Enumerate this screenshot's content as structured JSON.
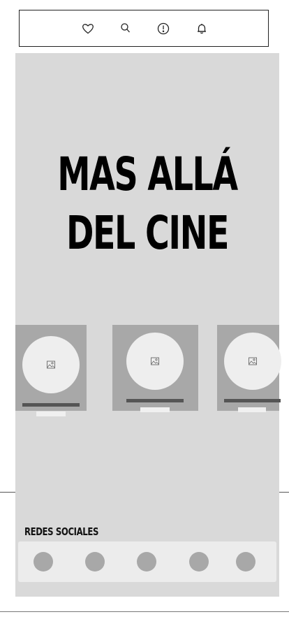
{
  "topbar": {
    "icons": [
      "heart-icon",
      "search-icon",
      "alert-icon",
      "bell-icon"
    ]
  },
  "hero": {
    "line1": "MAS ALLÁ",
    "line2": "DEL CINE"
  },
  "carousel": {
    "cards": [
      {
        "image": "image-placeholder-icon"
      },
      {
        "image": "image-placeholder-icon"
      },
      {
        "image": "image-placeholder-icon"
      }
    ]
  },
  "social": {
    "title": "REDES SOCIALES",
    "links": [
      "social-link",
      "social-link",
      "social-link",
      "social-link",
      "social-link"
    ]
  },
  "colors": {
    "panel": "#d9d9d9",
    "card": "#a8a8a8",
    "circle": "#eeeeee",
    "bar_dark": "#555555",
    "social_box": "#ececec"
  }
}
